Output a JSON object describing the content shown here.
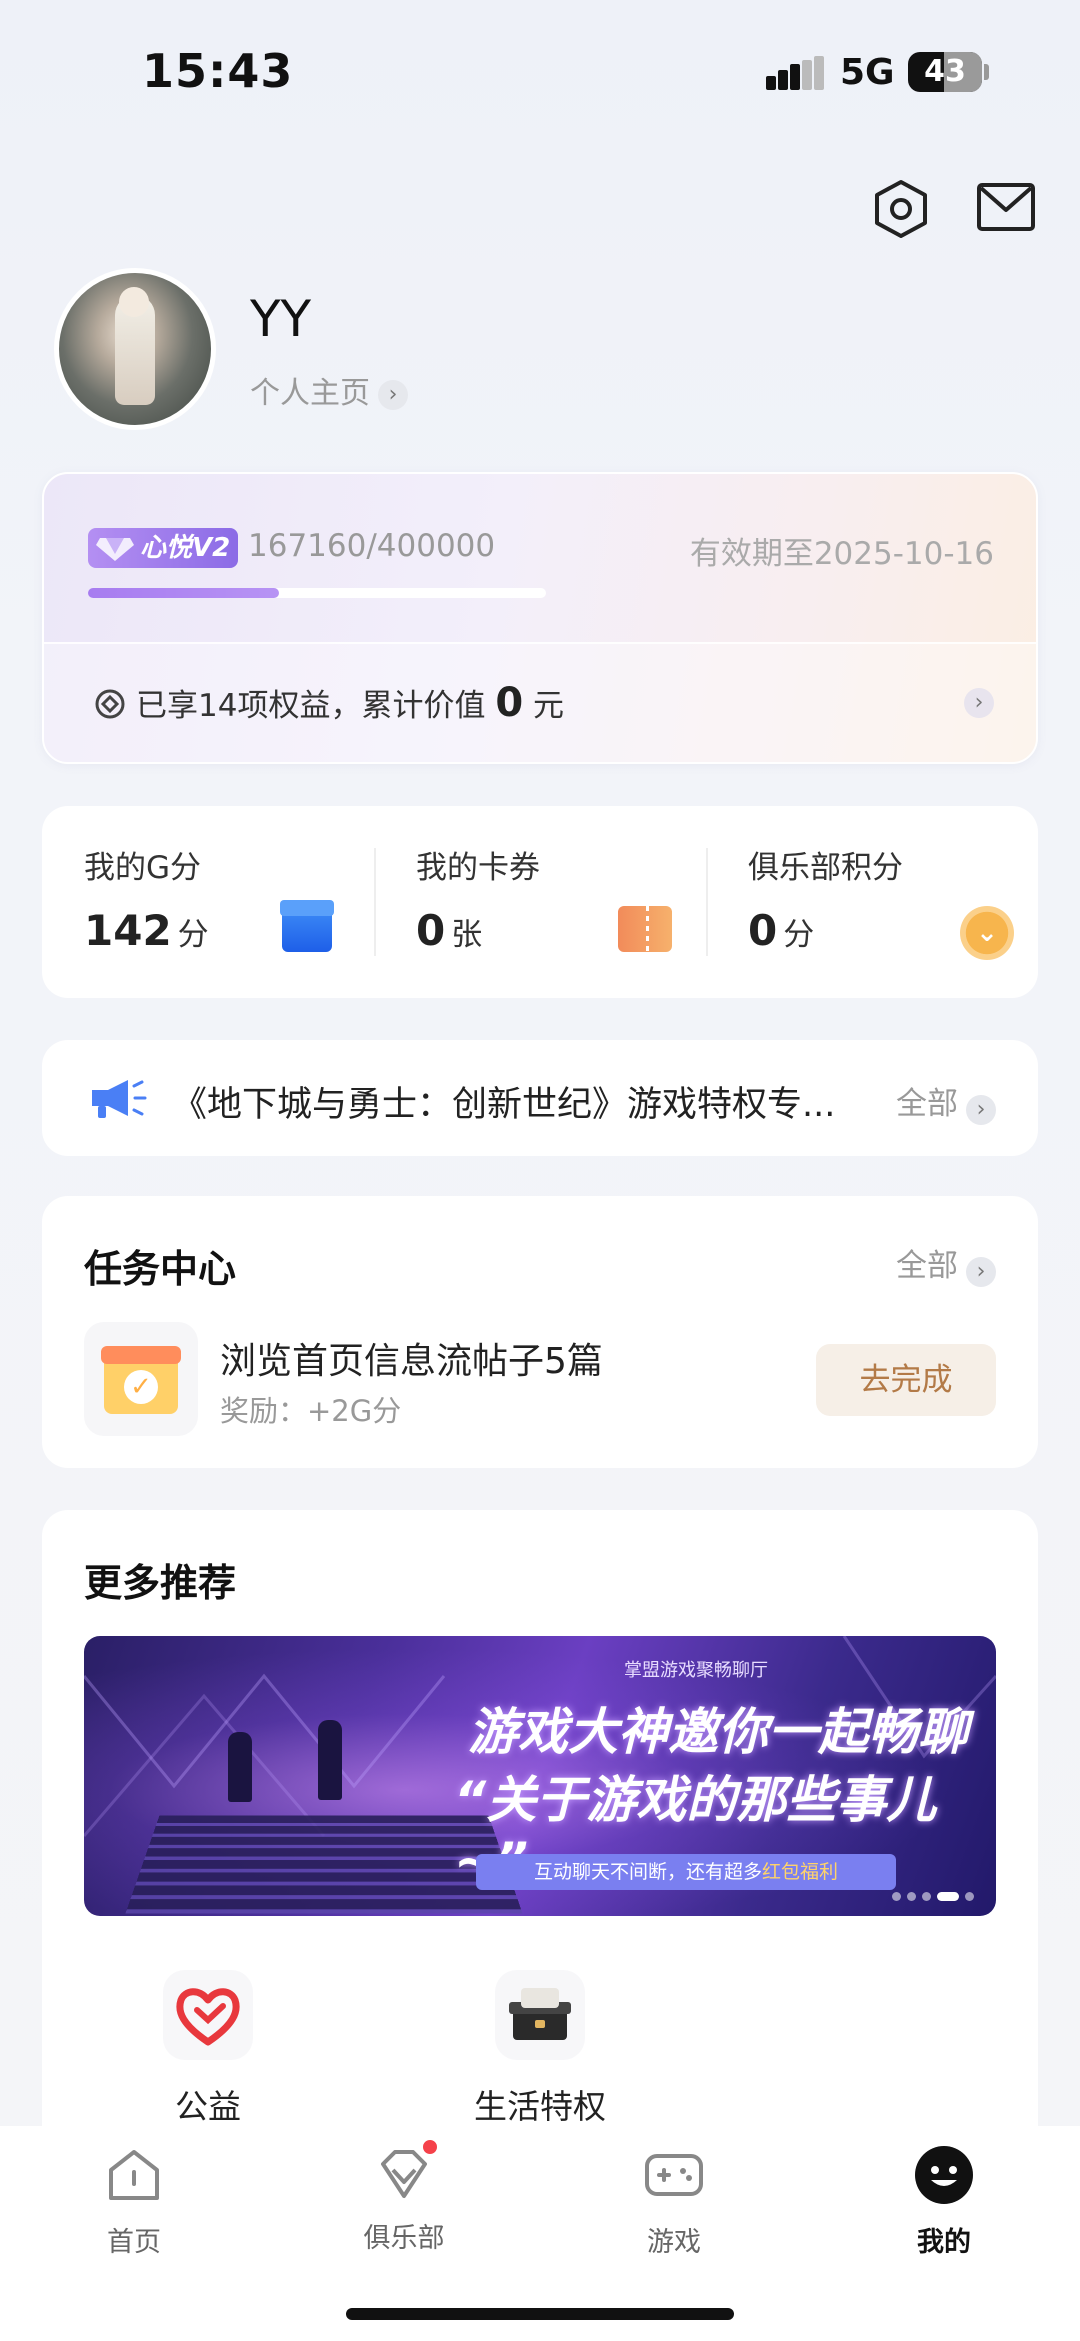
{
  "status_bar": {
    "time": "15:43",
    "network": "5G",
    "battery": "43"
  },
  "header": {
    "settings_icon": "settings-hexagon-icon",
    "mail_icon": "mail-icon"
  },
  "profile": {
    "username": "YY",
    "homepage_label": "个人主页"
  },
  "vip": {
    "level_label": "心悦V2",
    "progress_text": "167160/400000",
    "progress_fraction": 0.4179,
    "expiry": "有效期至2025-10-16",
    "benefit_prefix": "已享14项权益，累计价值",
    "benefit_value": "0",
    "benefit_unit": "元",
    "colors": {
      "accent": "#a77cf0"
    }
  },
  "points": {
    "g_points": {
      "label": "我的G分",
      "value": "142",
      "unit": "分"
    },
    "coupons": {
      "label": "我的卡券",
      "value": "0",
      "unit": "张"
    },
    "club_points": {
      "label": "俱乐部积分",
      "value": "0",
      "unit": "分"
    }
  },
  "notice": {
    "text": "《地下城与勇士：创新世纪》游戏特权专...",
    "all_label": "全部"
  },
  "tasks": {
    "title": "任务中心",
    "all_label": "全部",
    "item": {
      "name": "浏览首页信息流帖子5篇",
      "reward": "奖励：+2G分",
      "button": "去完成"
    }
  },
  "recommend": {
    "title": "更多推荐",
    "banner": {
      "subtitle": "掌盟游戏聚畅聊厅",
      "line1": "游戏大神邀你一起畅聊",
      "line2": "“关于游戏的那些事儿~”",
      "pill_prefix": "互动聊天不间断，还有超多",
      "pill_highlight": "红包福利"
    },
    "entries": [
      {
        "label": "公益",
        "icon": "charity-heart-icon"
      },
      {
        "label": "生活特权",
        "icon": "gift-box-icon"
      }
    ]
  },
  "tabbar": {
    "items": [
      {
        "label": "首页",
        "icon": "home-icon"
      },
      {
        "label": "俱乐部",
        "icon": "club-diamond-icon"
      },
      {
        "label": "游戏",
        "icon": "gamepad-icon"
      },
      {
        "label": "我的",
        "icon": "profile-smile-icon"
      }
    ],
    "active": "我的"
  }
}
